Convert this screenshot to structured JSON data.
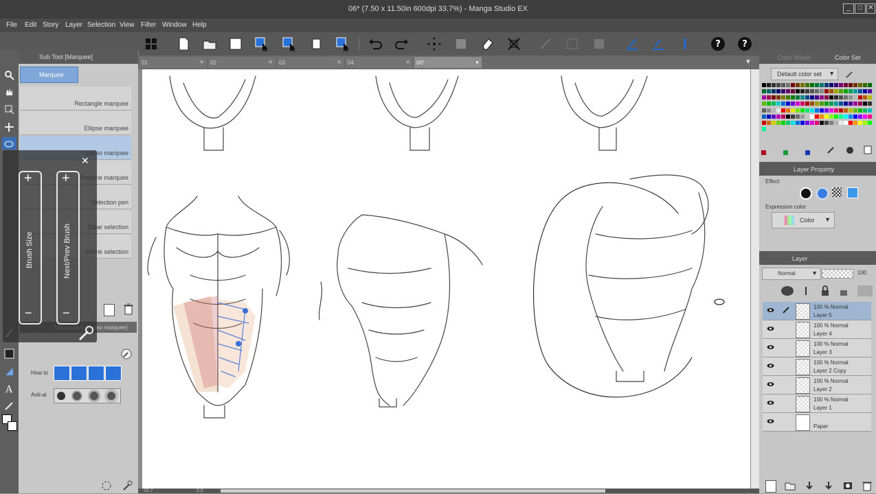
{
  "window": {
    "title": "06* (7.50 x 11.50in 600dpi 33.7%) - Manga Studio EX"
  },
  "menu": [
    "File",
    "Edit",
    "Story",
    "Layer",
    "Selection",
    "View",
    "Filter",
    "Window",
    "Help"
  ],
  "subtool": {
    "header": "Sub Tool [Marquee]",
    "group_tab": "Marquee",
    "items": [
      {
        "label": "Rectangle marquee"
      },
      {
        "label": "Ellipse marquee"
      },
      {
        "label": "Lasso marquee"
      },
      {
        "label": "Polyline marquee"
      },
      {
        "label": "Selection pen"
      },
      {
        "label": "Clear selection"
      },
      {
        "label": "Shrink selection"
      }
    ],
    "tool_property_tab": "Tool property [Lasso marquee]",
    "how_to_label": "How to",
    "anti_alias_label": "Anti-al"
  },
  "brush_overlay": {
    "left_slider": "Brush Size",
    "right_slider": "Next/Prev Brush",
    "plus": "+",
    "minus": "−",
    "close": "✕"
  },
  "tabs": [
    {
      "label": "01"
    },
    {
      "label": "02"
    },
    {
      "label": "03"
    },
    {
      "label": "04"
    },
    {
      "label": "06*",
      "active": true
    }
  ],
  "status": {
    "zoom": "33.7",
    "value": "0.0"
  },
  "color_panel": {
    "tab_wheel": "Color Wheel",
    "tab_set": "Color Set",
    "color_set_name": "Default color set"
  },
  "layer_property": {
    "header": "Layer Property",
    "effect_label": "Effect",
    "expression_label": "Expression color",
    "expression_value": "Color"
  },
  "layers_panel": {
    "header": "Layer",
    "blend_mode": "Normal",
    "opacity": "100",
    "layers": [
      {
        "meta": "100 %  Normal",
        "name": "Layer 5",
        "selected": true
      },
      {
        "meta": "100 %  Normal",
        "name": "Layer 4"
      },
      {
        "meta": "100 %  Normal",
        "name": "Layer 3"
      },
      {
        "meta": "100 %  Normal",
        "name": "Layer 2 Copy"
      },
      {
        "meta": "100 %  Normal",
        "name": "Layer 2"
      },
      {
        "meta": "100 %  Normal",
        "name": "Layer 1"
      },
      {
        "meta": "",
        "name": "Paper"
      }
    ]
  },
  "palette_colors": [
    "#000000",
    "#3a3a3a",
    "#6b6b6b",
    "#9a9a9a",
    "#c8c8c8",
    "#ffffff",
    "#ff0000",
    "#ff8000",
    "#ffff00",
    "#80ff00",
    "#00ff00",
    "#00ff80",
    "#00ffff",
    "#0080ff",
    "#0000ff",
    "#8000ff",
    "#ff00ff",
    "#ff0080",
    "#c00000",
    "#c06000",
    "#c0c000",
    "#60c000",
    "#00c000",
    "#00c060",
    "#00c0c0",
    "#0060c0",
    "#0000c0",
    "#6000c0",
    "#c000c0",
    "#c00060"
  ],
  "footer_colors": [
    "#b00020",
    "#1a9a3a",
    "#1a3ab0"
  ]
}
